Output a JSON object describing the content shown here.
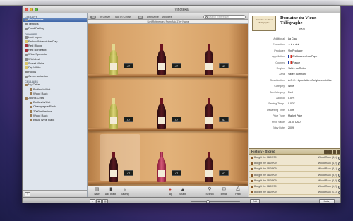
{
  "window": {
    "title": "Vinoteka"
  },
  "sidebar": {
    "library_header": "Library",
    "library": [
      {
        "label": "References",
        "selected": true
      },
      {
        "label": "Tastings"
      },
      {
        "label": "Food Pairing"
      }
    ],
    "groups_header": "Groups",
    "groups": [
      {
        "label": "Last Import"
      },
      {
        "label": "Parker Wine of the Day"
      },
      {
        "label": "Red Rhone"
      },
      {
        "label": "Red Bordeaux"
      },
      {
        "label": "Wine Spectator"
      },
      {
        "label": "Wish List"
      },
      {
        "label": "Sweet White"
      },
      {
        "label": "Dry White"
      },
      {
        "label": "Rocks"
      },
      {
        "label": "Czech selection"
      }
    ],
    "cellars_header": "Cellars",
    "cellars": [
      {
        "label": "My Cellar",
        "level": 0
      },
      {
        "label": "Bottles In/Out",
        "level": 1
      },
      {
        "label": "Wood Rack",
        "level": 1
      },
      {
        "label": "John's Cellar",
        "level": 0
      },
      {
        "label": "Bottles In/Out",
        "level": 1
      },
      {
        "label": "Champagne Rack",
        "level": 1
      },
      {
        "label": "2000 millesime",
        "level": 1
      },
      {
        "label": "Wood Rack",
        "level": 1
      },
      {
        "label": "Basic Wine Rack",
        "level": 1
      }
    ],
    "add_label": "+"
  },
  "filters": {
    "all": "All",
    "in_cellar": "In Cellar",
    "not_in_cellar": "Not in Cellar",
    "count": "All",
    "drinkable": "Drinkable",
    "apogee": "Apogee"
  },
  "search": {
    "placeholder": "Search References"
  },
  "sortbar": {
    "text": "Sort References From  A to Z   by  Name"
  },
  "shelves": {
    "rows": [
      {
        "bottles": [
          {
            "color": "white",
            "tag": "47"
          },
          {
            "color": "red",
            "tag": "47"
          },
          {
            "color": "red",
            "tag": "47"
          }
        ]
      },
      {
        "bottles": [
          {
            "color": "white",
            "tag": "47"
          },
          {
            "color": "red",
            "tag": "47"
          },
          {
            "color": "red",
            "tag": "47"
          }
        ]
      },
      {
        "bottles": [
          {
            "color": "red",
            "tag": "47"
          },
          {
            "color": "rose",
            "tag": "47"
          },
          {
            "color": "red",
            "tag": "47"
          }
        ]
      }
    ]
  },
  "toolbar": {
    "new": "New",
    "add_bottle": "Add Bottle",
    "tasting": "Tasting",
    "tag": "Tag",
    "shape": "Shape",
    "search": "Search",
    "email": "Email",
    "print": "Print"
  },
  "detail": {
    "label_text": "Domaine du Vieux Télégraphe",
    "name": "Domaine du Vieux Télégraphe",
    "year": "2005",
    "fields": [
      {
        "k": "Additional",
        "v": "La Crau"
      },
      {
        "k": "Evaluation",
        "v": "★★★★★"
      },
      {
        "k": "Producer",
        "v": "Vin Producer"
      },
      {
        "k": "Appellation",
        "v": "Châteauneuf-du-Pape",
        "flag": true
      },
      {
        "k": "Country",
        "v": "France",
        "flag": true
      },
      {
        "k": "Region",
        "v": "Vallée du Rhône"
      },
      {
        "k": "Area",
        "v": "Vallée du Rhône"
      },
      {
        "k": "Classification",
        "v": "A.O.C. - Appellation d'origine contrôlée"
      },
      {
        "k": "Category",
        "v": "Wine"
      },
      {
        "k": "SubCategory",
        "v": "Red"
      },
      {
        "k": "Alcohol",
        "v": "0.0 %"
      },
      {
        "k": "Serving Temp.",
        "v": "0.0 °C"
      },
      {
        "k": "Decanting Time",
        "v": "0.0 m"
      },
      {
        "k": "Price Type",
        "v": "Market Price"
      },
      {
        "k": "Price Value",
        "v": "75.00   USD"
      },
      {
        "k": "Entry Date",
        "v": "2009"
      }
    ]
  },
  "history": {
    "title": "History - Stored",
    "rows": [
      {
        "text": "Bought the 08/09/09",
        "right": "Wood Rack (4,1)"
      },
      {
        "text": "Bought the 08/09/09",
        "right": "Wood Rack (4,2)"
      },
      {
        "text": "Bought the 08/09/09",
        "right": "Wood Rack (3,1)"
      },
      {
        "text": "Bought the 08/09/09",
        "right": "Wood Rack (3,2)"
      },
      {
        "text": "Bought the 08/09/09",
        "right": "Wood Rack (2,2)"
      },
      {
        "text": "Bought the 08/09/09",
        "right": "Wood Rack (1,2)"
      },
      {
        "text": "Bought the 08/09/09",
        "right": "Wood Rack (1,1)"
      }
    ]
  },
  "status": {
    "edit": "Edit",
    "history": "History"
  },
  "colors": {
    "selection": "#3e66a8",
    "wood": "#e2b27a",
    "red_wine": "#5a1a22",
    "white_wine": "#dcd67a"
  }
}
